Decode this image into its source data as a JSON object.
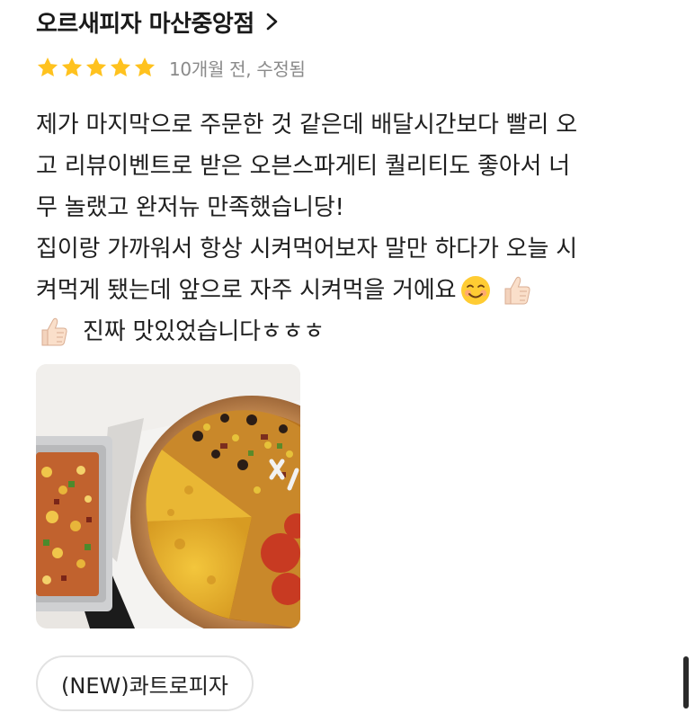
{
  "store": {
    "name": "오르새피자 마산중앙점",
    "chevron_icon": "chevron-right-icon"
  },
  "review": {
    "rating": 5,
    "rating_max": 5,
    "star_color": "#ffc21e",
    "meta": "10개월 전, 수정됨",
    "lines": [
      "제가 마지막으로 주문한 것 같은데 배달시간보다 빨리 오",
      "고 리뷰이벤트로 받은 오븐스파게티 퀄리티도 좋아서 너",
      "무 놀랬고 완저뉴 만족했습니당!",
      "집이랑 가까워서 항상 시켜먹어보자 말만 하다가 오늘 시",
      "켜먹게 됐는데 앞으로 자주 시켜먹을 거에요",
      "진짜 맛있었습니다ㅎㅎㅎ"
    ],
    "emojis": {
      "smiling": "smiling-face-emoji",
      "thumbs_up": "thumbs-up-emoji"
    }
  },
  "photo": {
    "subject": "pizza-and-oven-spaghetti-photo"
  },
  "menu_chip": {
    "label": "(NEW)콰트로피자"
  }
}
